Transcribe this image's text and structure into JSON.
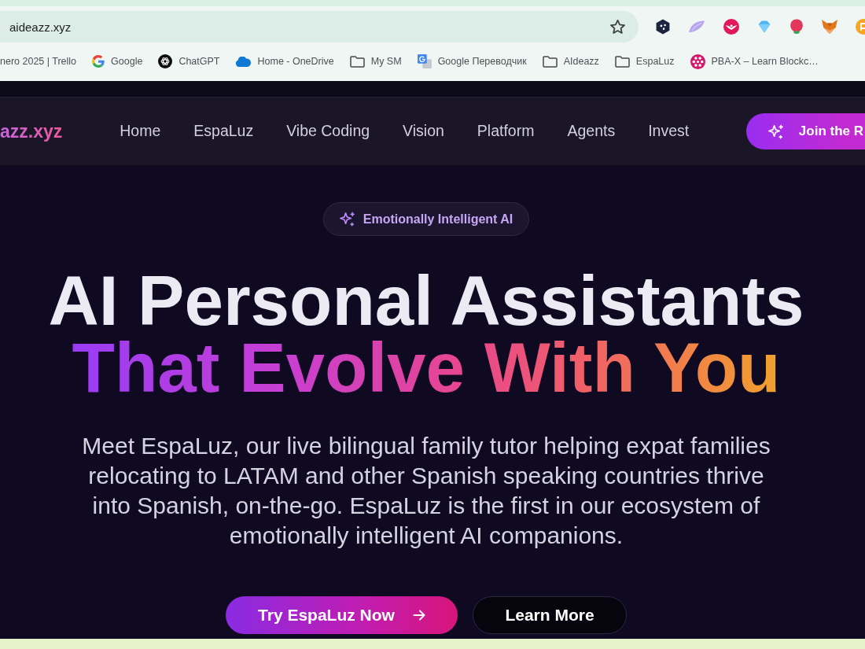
{
  "browser": {
    "address": "aideazz.xyz",
    "bookmarks": [
      {
        "label": "nero 2025 | Trello",
        "kind": "none"
      },
      {
        "label": "Google",
        "kind": "g-logo"
      },
      {
        "label": "ChatGPT",
        "kind": "knot"
      },
      {
        "label": "Home - OneDrive",
        "kind": "cloud"
      },
      {
        "label": "My SM",
        "kind": "folder"
      },
      {
        "label": "Google Переводчик",
        "kind": "translate"
      },
      {
        "label": "AIdeazz",
        "kind": "folder"
      },
      {
        "label": "EspaLuz",
        "kind": "folder"
      },
      {
        "label": "PBA-X – Learn Blockc…",
        "kind": "flower"
      }
    ]
  },
  "nav": {
    "logo": "azz.xyz",
    "links": [
      "Home",
      "EspaLuz",
      "Vibe Coding",
      "Vision",
      "Platform",
      "Agents",
      "Invest"
    ],
    "cta": "Join the R"
  },
  "hero": {
    "badge": "Emotionally Intelligent AI",
    "title": "AI Personal Assistants",
    "title_highlight": "That Evolve With You",
    "description": "Meet EspaLuz, our live bilingual family tutor helping expat families relocating to LATAM and other Spanish speaking countries thrive into Spanish, on-the-go. EspaLuz is the first in our ecosystem of emotionally intelligent AI companions.",
    "buttons": [
      {
        "label": "Try EspaLuz Now",
        "kind": "primary"
      },
      {
        "label": "Learn More",
        "kind": "secondary"
      }
    ]
  }
}
